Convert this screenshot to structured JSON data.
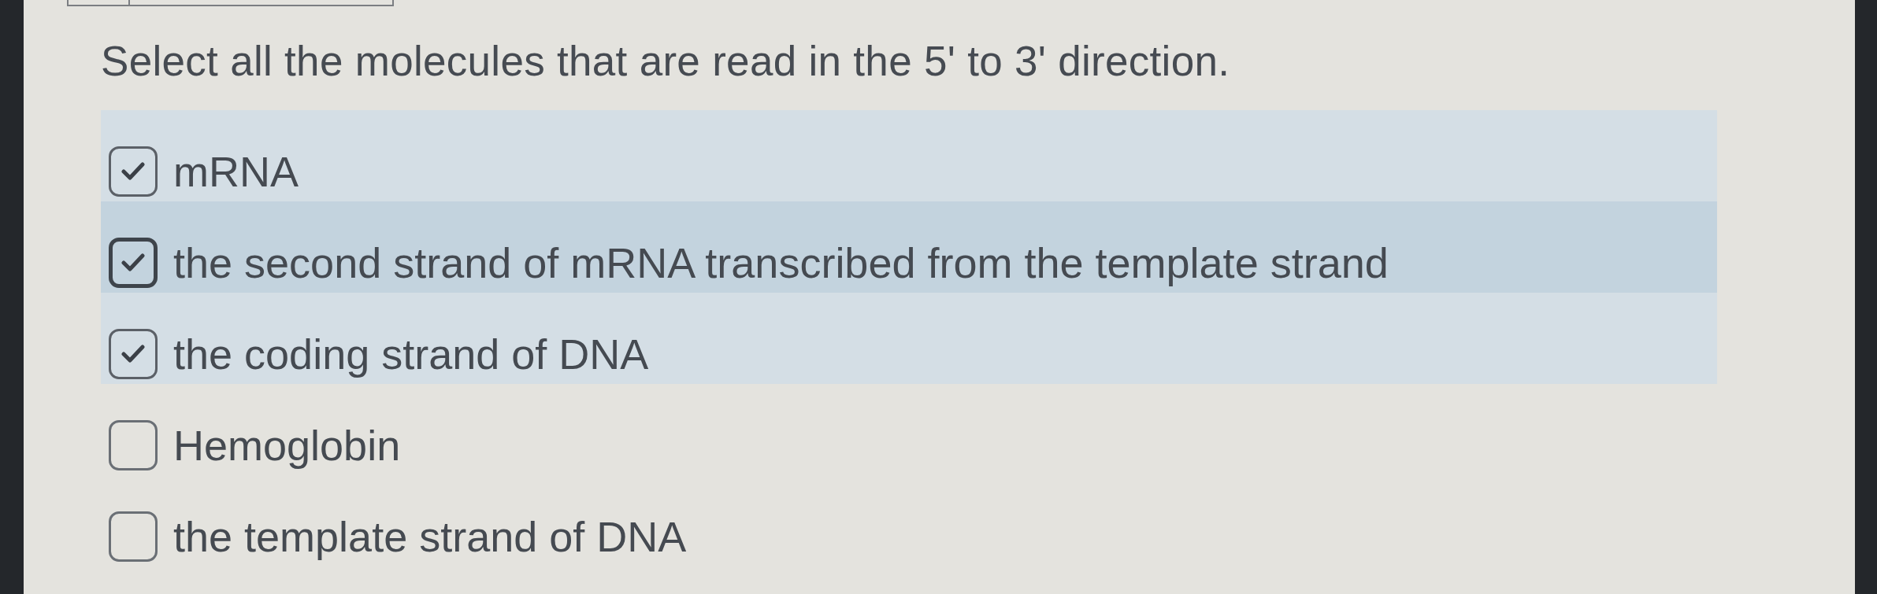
{
  "question": "Select all the molecules that are read in the 5' to 3' direction.",
  "options": [
    {
      "label": "mRNA",
      "checked": true,
      "focused": false
    },
    {
      "label": "the second strand of mRNA transcribed from the template strand",
      "checked": true,
      "focused": true
    },
    {
      "label": "the coding strand of DNA",
      "checked": true,
      "focused": false
    },
    {
      "label": "Hemoglobin",
      "checked": false,
      "focused": false
    },
    {
      "label": "the template strand of DNA",
      "checked": false,
      "focused": false
    }
  ]
}
